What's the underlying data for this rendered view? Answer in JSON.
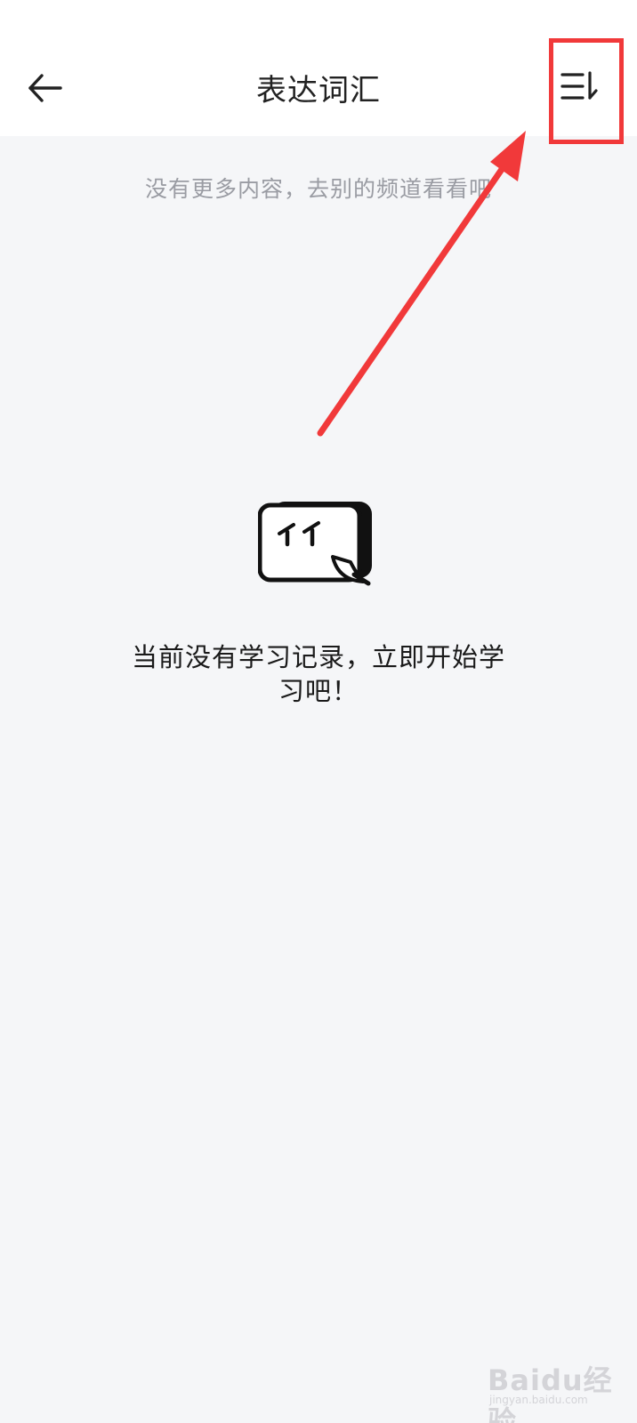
{
  "header": {
    "title": "表达词汇",
    "back_icon": "arrow-left-icon",
    "sort_icon": "sort-list-icon"
  },
  "feed": {
    "end_hint": "没有更多内容，去别的频道看看吧"
  },
  "empty_state": {
    "illustration": "empty-face-icon",
    "message": "当前没有学习记录，立即开始学习吧！"
  },
  "annotation": {
    "color": "#f1393a"
  },
  "watermark": {
    "brand": "Baidu经验",
    "url": "jingyan.baidu.com"
  }
}
